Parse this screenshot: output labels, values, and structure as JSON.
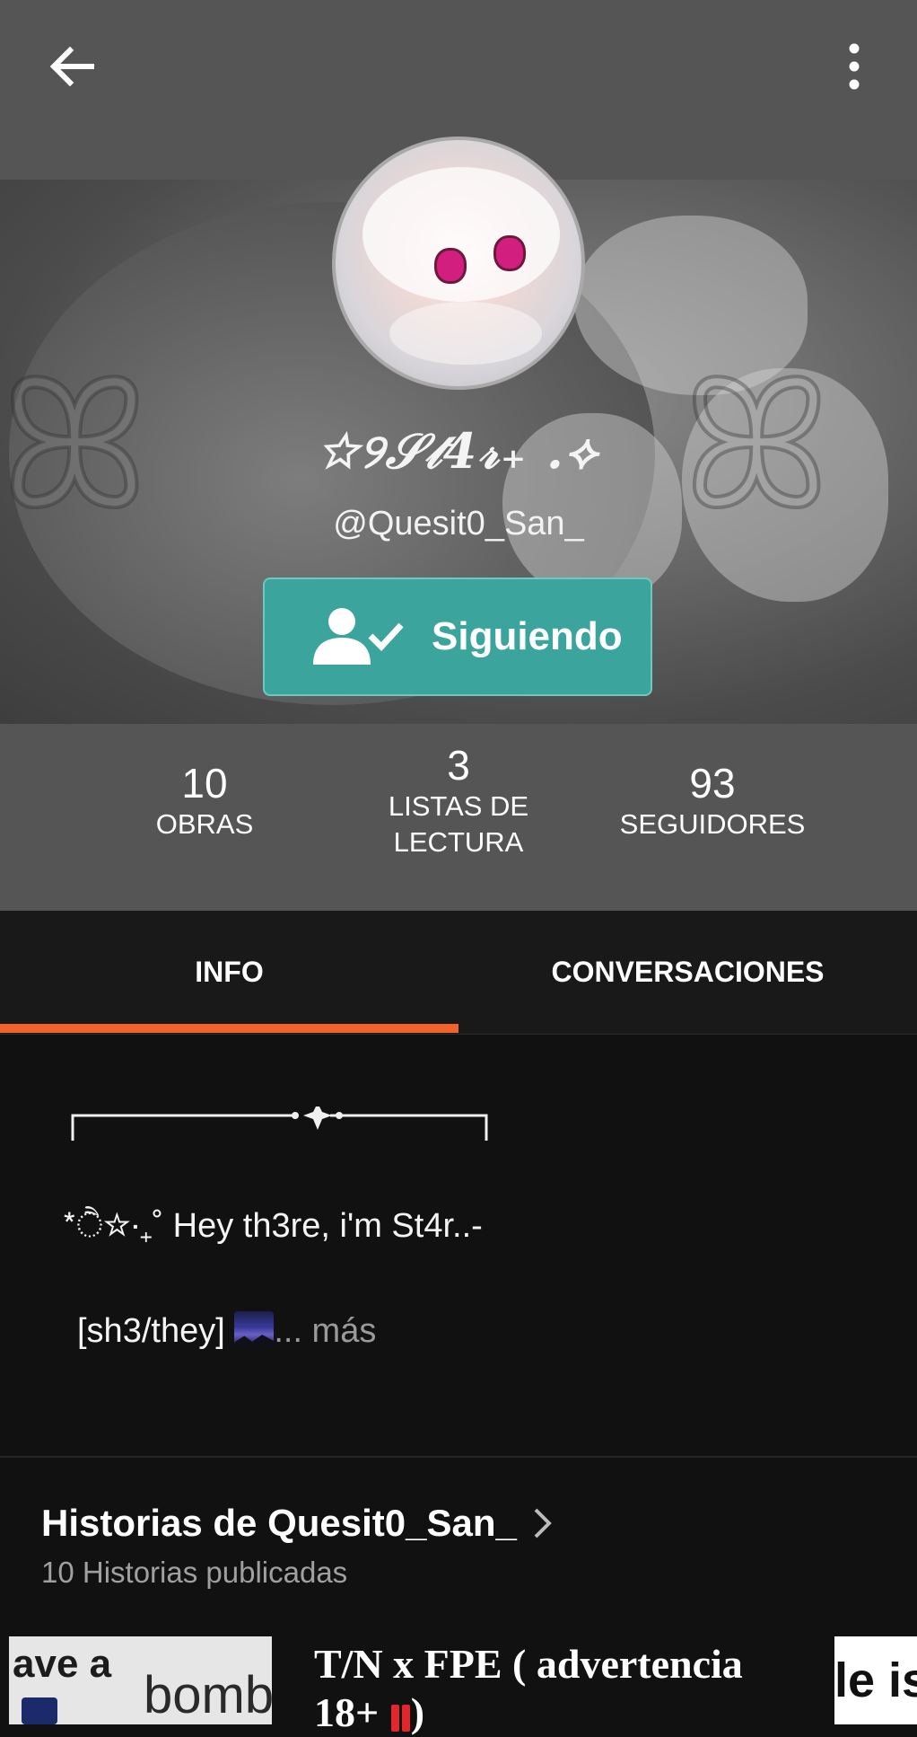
{
  "header": {
    "back_icon": "arrow-left-icon",
    "menu_icon": "more-vertical-icon",
    "display_name": "☆୨𝒮𝓉4𝓇₊ .⟡",
    "handle": "@Quesit0_San_",
    "follow_button": {
      "label": "Siguiendo",
      "icon": "user-check-icon",
      "color": "#3aa49d"
    }
  },
  "stats": [
    {
      "value": "10",
      "label": "OBRAS"
    },
    {
      "value": "3",
      "label_line1": "LISTAS DE",
      "label_line2": "LECTURA"
    },
    {
      "value": "93",
      "label": "SEGUIDORES"
    }
  ],
  "tabs": [
    {
      "label": "INFO",
      "active": true
    },
    {
      "label": "CONVERSACIONES",
      "active": false
    }
  ],
  "accent_color": "#f0642b",
  "bio": {
    "line1": "*ੈ☆‧₊˚ Hey th3re, i'm St4r..-",
    "line2": "[sh3/they]",
    "line2_emoji": "night-sky-emoji",
    "more": "... más"
  },
  "stories": {
    "title": "Historias de Quesit0_San_",
    "subtitle": "10 Historias publicadas",
    "items": [
      {
        "thumb_text_1": "ave a",
        "thumb_text_2": "bomb",
        "title": "T/N x FPE ( advertencia 18+",
        "title_end": ")"
      },
      {
        "thumb_text": "le is"
      }
    ]
  }
}
